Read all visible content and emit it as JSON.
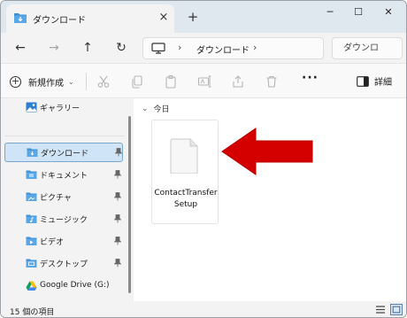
{
  "window": {
    "tab_title": "ダウンロード",
    "tab_close_icon": "×",
    "new_tab_icon": "+",
    "minimize_icon": "─",
    "maximize_icon": "☐",
    "close_icon": "✕"
  },
  "nav": {
    "back_icon": "←",
    "forward_icon": "→",
    "up_icon": "↑",
    "refresh_icon": "↻",
    "address_sep": "›",
    "address_path": "ダウンロード",
    "search_placeholder": "ダウンロ"
  },
  "commands": {
    "new_label": "新規作成",
    "new_chevron": "⌄",
    "more_label": "···",
    "details_label": "詳細"
  },
  "sidebar": {
    "gallery": "ギャラリー",
    "items": [
      {
        "label": "ダウンロード",
        "selected": true,
        "pinned": true,
        "icon": "download-folder-icon"
      },
      {
        "label": "ドキュメント",
        "selected": false,
        "pinned": true,
        "icon": "documents-folder-icon"
      },
      {
        "label": "ピクチャ",
        "selected": false,
        "pinned": true,
        "icon": "pictures-folder-icon"
      },
      {
        "label": "ミュージック",
        "selected": false,
        "pinned": true,
        "icon": "music-folder-icon"
      },
      {
        "label": "ビデオ",
        "selected": false,
        "pinned": true,
        "icon": "videos-folder-icon"
      },
      {
        "label": "デスクトップ",
        "selected": false,
        "pinned": true,
        "icon": "desktop-folder-icon"
      },
      {
        "label": "Google Drive (G:)",
        "selected": false,
        "pinned": false,
        "icon": "google-drive-icon"
      }
    ]
  },
  "content": {
    "group_chevron": "⌄",
    "group_label": "今日",
    "file_name": "ContactTransferSetup"
  },
  "status": {
    "item_count": "15 個の項目"
  },
  "colors": {
    "accent": "#0067c0",
    "selection": "#cfe4f6",
    "arrow_red": "#d40000",
    "folder_blue": "#4a9be0"
  }
}
